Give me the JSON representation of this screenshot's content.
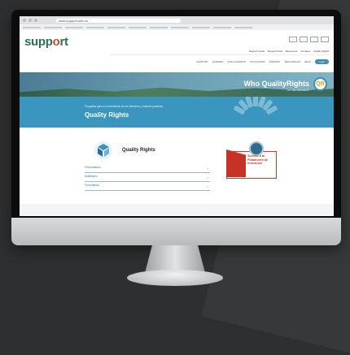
{
  "browser": {
    "url": "www.support-site.eu",
    "bookmarks": [
      "",
      "",
      "",
      "",
      "",
      "",
      "",
      "",
      "",
      "",
      ""
    ]
  },
  "header": {
    "logo_text_pre": "supp",
    "logo_text_o": "o",
    "logo_text_post": "rt",
    "utility_links": [
      "Support portal",
      "Support Tools",
      "Resources",
      "Contacto",
      "Quality Rights"
    ],
    "nav_items": [
      "SUPPORT",
      "QUIENES",
      "QUE HACEMOS",
      "ACTUALIDAD",
      "ESPAÑOL",
      "DESCARGAR",
      "HELP"
    ],
    "nav_pill_label": "Login"
  },
  "hero": {
    "title": "Who QualityRights",
    "subtitle": "Ver más información",
    "badge": "QR"
  },
  "band": {
    "small_text": "Programa para el conocimiento de los derechos y mejores prácticas",
    "title": "Quality Rights"
  },
  "card": {
    "title": "Quality Rights",
    "links": [
      {
        "label": "Presentación"
      },
      {
        "label": "Materiales"
      },
      {
        "label": "Formularios"
      }
    ]
  },
  "promo": {
    "text": "Acceso a la Plataforma de formación"
  },
  "colors": {
    "brand_green": "#2f6e58",
    "accent_blue": "#3a95bf",
    "promo_red": "#c73226"
  }
}
